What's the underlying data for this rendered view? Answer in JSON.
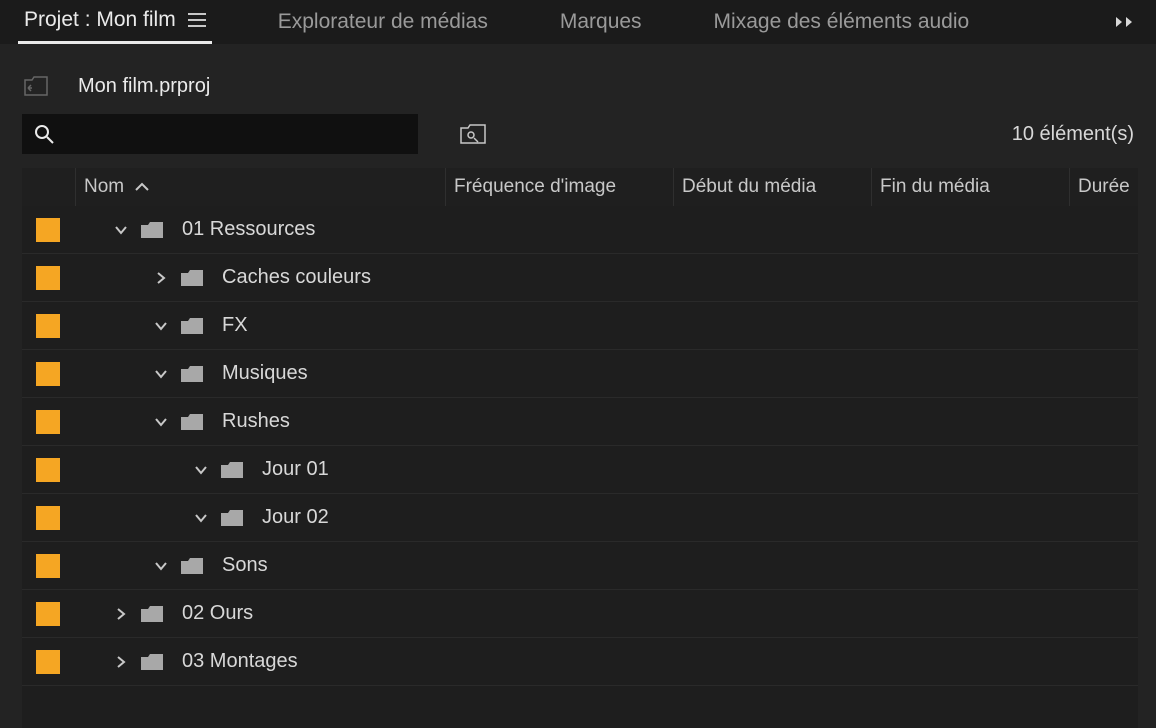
{
  "tabs": [
    {
      "label": "Projet : Mon film",
      "active": true,
      "hasMenu": true
    },
    {
      "label": "Explorateur de médias",
      "active": false
    },
    {
      "label": "Marques",
      "active": false
    },
    {
      "label": "Mixage des éléments audio",
      "active": false
    }
  ],
  "breadcrumb": {
    "file": "Mon film.prproj"
  },
  "search": {
    "placeholder": ""
  },
  "item_count": "10 élément(s)",
  "columns": {
    "name": "Nom",
    "fps": "Fréquence d'image",
    "start": "Début du média",
    "end": "Fin du média",
    "duration": "Durée"
  },
  "rows": [
    {
      "label": "01 Ressources",
      "indent": 0,
      "expander": "down"
    },
    {
      "label": "Caches couleurs",
      "indent": 1,
      "expander": "right"
    },
    {
      "label": "FX",
      "indent": 1,
      "expander": "down"
    },
    {
      "label": "Musiques",
      "indent": 1,
      "expander": "down"
    },
    {
      "label": "Rushes",
      "indent": 1,
      "expander": "down"
    },
    {
      "label": "Jour 01",
      "indent": 2,
      "expander": "down"
    },
    {
      "label": "Jour 02",
      "indent": 2,
      "expander": "down"
    },
    {
      "label": "Sons",
      "indent": 1,
      "expander": "down"
    },
    {
      "label": "02 Ours",
      "indent": 0,
      "expander": "right"
    },
    {
      "label": "03 Montages",
      "indent": 0,
      "expander": "right"
    }
  ],
  "colors": {
    "swatch": "#f5a623"
  }
}
